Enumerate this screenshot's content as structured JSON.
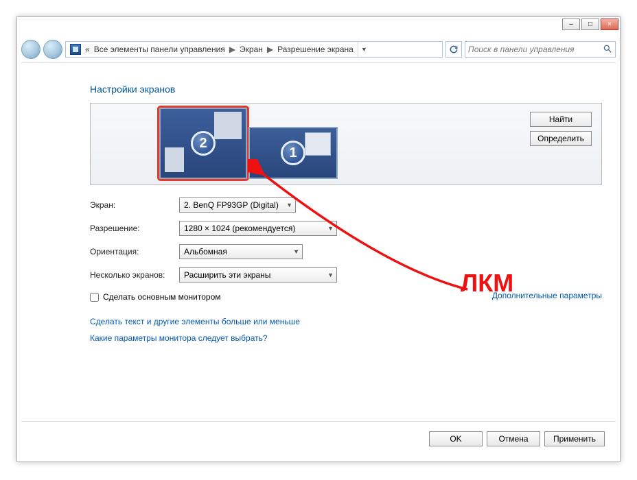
{
  "window": {
    "minimize": "–",
    "maximize": "□",
    "close": "×"
  },
  "breadcrumb": {
    "prefix": "«",
    "items": [
      "Все элементы панели управления",
      "Экран",
      "Разрешение экрана"
    ]
  },
  "search": {
    "placeholder": "Поиск в панели управления"
  },
  "title": "Настройки экранов",
  "canvas_buttons": {
    "find": "Найти",
    "identify": "Определить"
  },
  "monitors": [
    {
      "number": "2",
      "selected": true
    },
    {
      "number": "1",
      "selected": false
    }
  ],
  "form": {
    "labels": {
      "screen": "Экран:",
      "resolution": "Разрешение:",
      "orientation": "Ориентация:",
      "multiple": "Несколько экранов:"
    },
    "values": {
      "screen": "2. BenQ FP93GP (Digital)",
      "resolution": "1280 × 1024 (рекомендуется)",
      "orientation": "Альбомная",
      "multiple": "Расширить эти экраны"
    }
  },
  "checkbox": {
    "label": "Сделать основным монитором",
    "checked": false
  },
  "links": {
    "advanced": "Дополнительные параметры",
    "text_size": "Сделать текст и другие элементы больше или меньше",
    "help": "Какие параметры монитора следует выбрать?"
  },
  "footer": {
    "ok": "OK",
    "cancel": "Отмена",
    "apply": "Применить"
  },
  "annotation": {
    "label": "ЛКМ"
  },
  "colors": {
    "accent": "#005693",
    "link": "#0058b0",
    "annotation": "#e11"
  }
}
